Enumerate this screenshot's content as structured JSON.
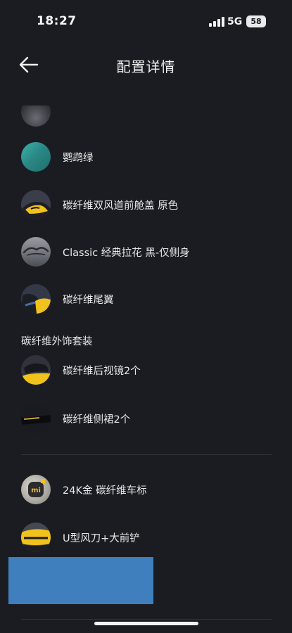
{
  "status_bar": {
    "time": "18:27",
    "network": "5G",
    "battery": "58"
  },
  "header": {
    "title": "配置详情",
    "back_icon": "arrow-left-icon"
  },
  "items": [
    {
      "label": "鹦鹉绿",
      "icon": "color-swatch-teal",
      "swatch": "#2a8a86"
    },
    {
      "label": "碳纤维双风道前舱盖 原色",
      "icon": "carbon-hood-thumbnail"
    },
    {
      "label": "Classic 经典拉花 黑-仅侧身",
      "icon": "decal-thumbnail"
    },
    {
      "label": "碳纤维尾翼",
      "icon": "carbon-spoiler-thumbnail"
    }
  ],
  "section": {
    "title": "碳纤维外饰套装",
    "items": [
      {
        "label": "碳纤维后视镜2个",
        "icon": "mirror-thumbnail"
      },
      {
        "label": "碳纤维侧裙2个",
        "icon": "side-skirt-thumbnail"
      }
    ]
  },
  "more_items": [
    {
      "label": "24K金 碳纤维车标",
      "icon": "badge-thumbnail"
    },
    {
      "label": "U型风刀+大前铲",
      "icon": "front-lip-thumbnail"
    }
  ],
  "colors": {
    "background": "#1b1c21",
    "text": "#e8e8ea",
    "accent_yellow": "#f1c21b",
    "redaction": "#3f7fbd"
  }
}
